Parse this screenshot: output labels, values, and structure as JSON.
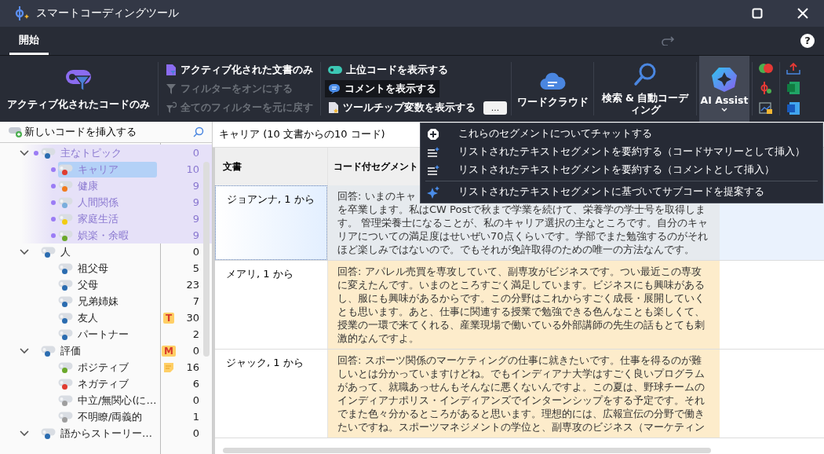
{
  "window": {
    "title": "スマートコーディングツール"
  },
  "tabs": [
    {
      "label": "開始",
      "selected": true
    }
  ],
  "help_button": "?",
  "ribbon": {
    "big_buttons": [
      {
        "label": "アクティブ化されたコードのみ",
        "kind": "code-filter"
      }
    ],
    "filter_items": [
      {
        "label": "アクティブ化された文書のみ",
        "disabled": false,
        "kind": "doc"
      },
      {
        "label": "フィルターをオンにする",
        "disabled": true,
        "kind": "funnel"
      },
      {
        "label": "全てのフィルターを元に戻す",
        "disabled": true,
        "kind": "reset"
      }
    ],
    "toggle_items": [
      {
        "label": "上位コードを表示する",
        "on": false,
        "kind": "tag"
      },
      {
        "label": "コメントを表示する",
        "on": true,
        "kind": "comment"
      },
      {
        "label": "ツールチップ変数を表示する",
        "on": false,
        "kind": "tooltip"
      }
    ],
    "more_button": "...",
    "tools": [
      {
        "label": "ワードクラウド",
        "kind": "cloud",
        "selected": false
      },
      {
        "label": "検索 & 自動コーディング",
        "kind": "search",
        "selected": false
      },
      {
        "label": "AI Assist",
        "kind": "ai",
        "selected": true
      }
    ]
  },
  "code_panel": {
    "insert_label": "新しいコードを挿入する",
    "codes": [
      {
        "label": "主なトピック",
        "count": "0",
        "color": "#2b6cb0",
        "activated": true,
        "selected": false,
        "expanded": true,
        "children": [
          {
            "label": "キャリア",
            "count": "10",
            "color": "#e03c31",
            "activated": true,
            "selected": true
          },
          {
            "label": "健康",
            "count": "9",
            "color": "#f07c1e",
            "activated": true,
            "selected": false
          },
          {
            "label": "人間関係",
            "count": "9",
            "color": "#7aaedc",
            "activated": true,
            "selected": false
          },
          {
            "label": "家庭生活",
            "count": "9",
            "color": "#f2cc14",
            "activated": true,
            "selected": false
          },
          {
            "label": "娯楽・余暇",
            "count": "9",
            "color": "#6aa82a",
            "activated": true,
            "selected": false
          }
        ]
      },
      {
        "label": "人",
        "count": "0",
        "color": "#2b6cb0",
        "activated": false,
        "selected": false,
        "expanded": true,
        "children": [
          {
            "label": "祖父母",
            "count": "5",
            "color": "#2b6cb0",
            "activated": false,
            "selected": false
          },
          {
            "label": "父母",
            "count": "23",
            "color": "#2b6cb0",
            "activated": false,
            "selected": false
          },
          {
            "label": "兄弟姉妹",
            "count": "7",
            "color": "#2b6cb0",
            "activated": false,
            "selected": false
          },
          {
            "label": "友人",
            "count": "30",
            "color": "#2b6cb0",
            "activated": false,
            "selected": false,
            "badge": "T"
          },
          {
            "label": "パートナー",
            "count": "2",
            "color": "#2b6cb0",
            "activated": false,
            "selected": false
          }
        ]
      },
      {
        "label": "評価",
        "count": "0",
        "color": "#2b6cb0",
        "activated": false,
        "selected": false,
        "expanded": true,
        "badge": "M",
        "children": [
          {
            "label": "ポジティブ",
            "count": "16",
            "color": "#6aa82a",
            "activated": false,
            "selected": false,
            "memo": true
          },
          {
            "label": "ネガティブ",
            "count": "6",
            "color": "#e03c31",
            "activated": false,
            "selected": false
          },
          {
            "label": "中立/無関心(に…",
            "count": "0",
            "color": "#9e9e9e",
            "activated": false,
            "selected": false
          },
          {
            "label": "不明瞭/両義的",
            "count": "1",
            "color": "#9e9e9e",
            "activated": false,
            "selected": false
          }
        ]
      },
      {
        "label": "語からストーリー…",
        "count": "0",
        "color": "#2b6cb0",
        "activated": false,
        "selected": false,
        "expanded": true
      }
    ]
  },
  "segments": {
    "title": "キャリア (10 文書からの10 コード)",
    "columns": [
      "文書",
      "コード付セグメント"
    ],
    "rows": [
      {
        "document": "ジョアンナ, 1 から",
        "lead": "回答: いまのキャ",
        "text": "を卒業します。私はCW Postで秋まで学業を続けて、栄養学の学士号を取得します。 管理栄養士になることが、私のキャリア選択の主なところです。自分のキャリアについての満足度はせいぜい70点くらいです。学部でまた勉強するのがそれほど楽しみではないので。でもそれが免許取得のための唯一の方法なんです。",
        "selected": true
      },
      {
        "document": "メアリ, 1 から",
        "text": "回答: アパレル売買を専攻していて、副専攻がビジネスです。つい最近この専攻に変えたんです。いまのところすごく満足しています。ビジネスにも興味があるし、服にも興味があるからです。この分野はこれからすごく成長・展開していくとも思います。あと、仕事に関連する授業で勉強できる色んなことも楽しくて、授業の一環で来てくれる、産業現場で働いている外部講師の先生の話もとても刺激的なんですよ。",
        "selected": false
      },
      {
        "document": "ジャック, 1 から",
        "text": "回答: スポーツ関係のマーケティングの仕事に就きたいです。仕事を得るのが難しいとは分かっていますけどね。でもインディアナ大学はすごく良いプログラムがあって、就職あっせんもそんなに悪くないんですよ。この夏は、野球チームのインディアナポリス・インディアンズでインターンシップをする予定です。それでまた色々分かるところがあると思います。理想的には、広報宣伝の分野で働きたいですね。スポーツマネジメントの学位と、副専攻のビジネス（マーケティン",
        "selected": false
      }
    ]
  },
  "ai_menu": [
    {
      "label": "これらのセグメントについてチャットする",
      "kind": "chat",
      "divider_before": false
    },
    {
      "label": "リストされたテキストセグメントを要約する（コードサマリーとして挿入）",
      "kind": "summary",
      "divider_before": false
    },
    {
      "label": "リストされたテキストセグメントを要約する（コメントとして挿入）",
      "kind": "summary",
      "divider_before": false
    },
    {
      "label": "リストされたテキストセグメントに基づいてサブコードを提案する",
      "kind": "suggest",
      "divider_before": true
    }
  ]
}
